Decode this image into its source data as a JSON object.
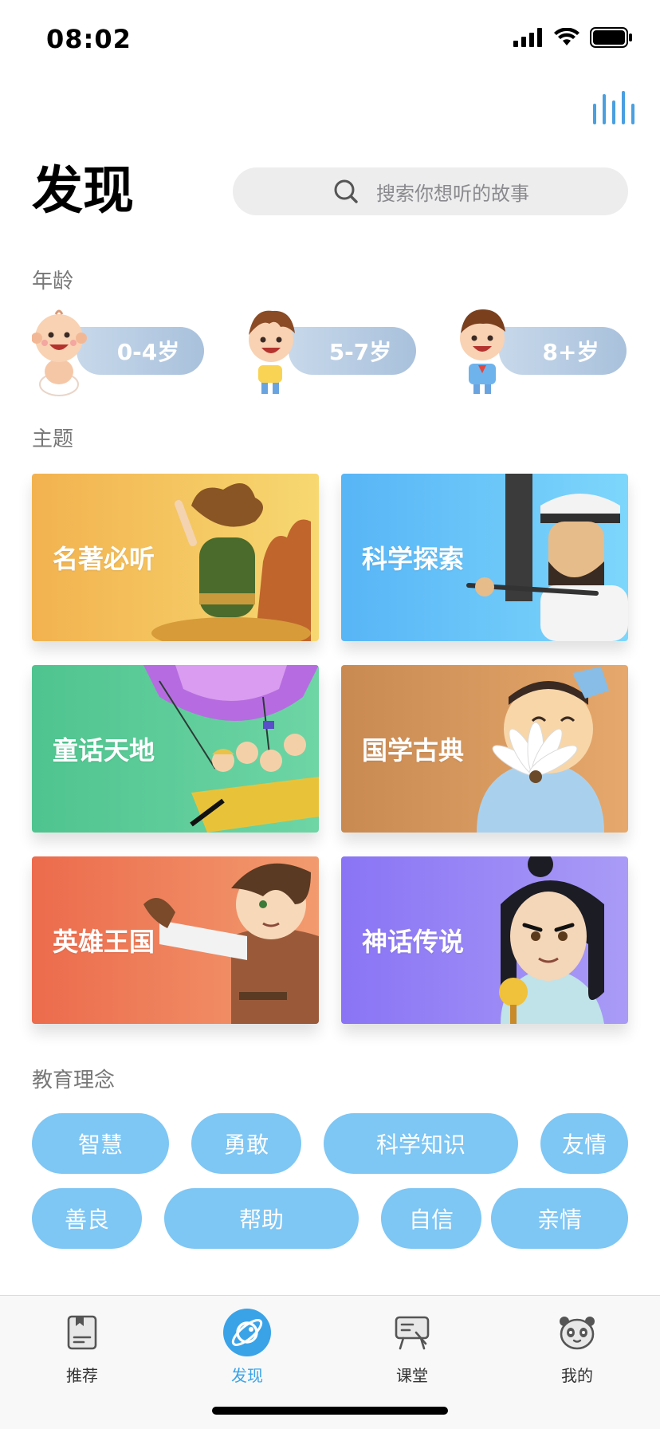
{
  "status_bar": {
    "time": "08:02"
  },
  "header": {
    "title": "发现",
    "search_placeholder": "搜索你想听的故事"
  },
  "age": {
    "label": "年龄",
    "items": [
      {
        "label": "0-4岁"
      },
      {
        "label": "5-7岁"
      },
      {
        "label": "8+岁"
      }
    ]
  },
  "topics": {
    "label": "主题",
    "items": [
      {
        "label": "名著必听",
        "color_start": "#f2b24f",
        "color_end": "#f7d871"
      },
      {
        "label": "科学探索",
        "color_start": "#58b5f6",
        "color_end": "#7dd6fb"
      },
      {
        "label": "童话天地",
        "color_start": "#4fc48f",
        "color_end": "#6ed5a5"
      },
      {
        "label": "国学古典",
        "color_start": "#c98a52",
        "color_end": "#e6a86c"
      },
      {
        "label": "英雄王国",
        "color_start": "#ec6b4d",
        "color_end": "#f29b6f"
      },
      {
        "label": "神话传说",
        "color_start": "#8a74f5",
        "color_end": "#a99bf6"
      }
    ]
  },
  "values": {
    "label": "教育理念",
    "row1": [
      "智慧",
      "勇敢",
      "科学知识",
      "友情"
    ],
    "row2": [
      "善良",
      "帮助",
      "自信",
      "亲情"
    ]
  },
  "bottom_nav": {
    "items": [
      {
        "label": "推荐",
        "icon": "book-icon",
        "active": false
      },
      {
        "label": "发现",
        "icon": "planet-icon",
        "active": true
      },
      {
        "label": "课堂",
        "icon": "classroom-icon",
        "active": false
      },
      {
        "label": "我的",
        "icon": "panda-icon",
        "active": false
      }
    ]
  },
  "colors": {
    "accent": "#3aa3e8",
    "tag_bg": "#7ec6f4"
  }
}
